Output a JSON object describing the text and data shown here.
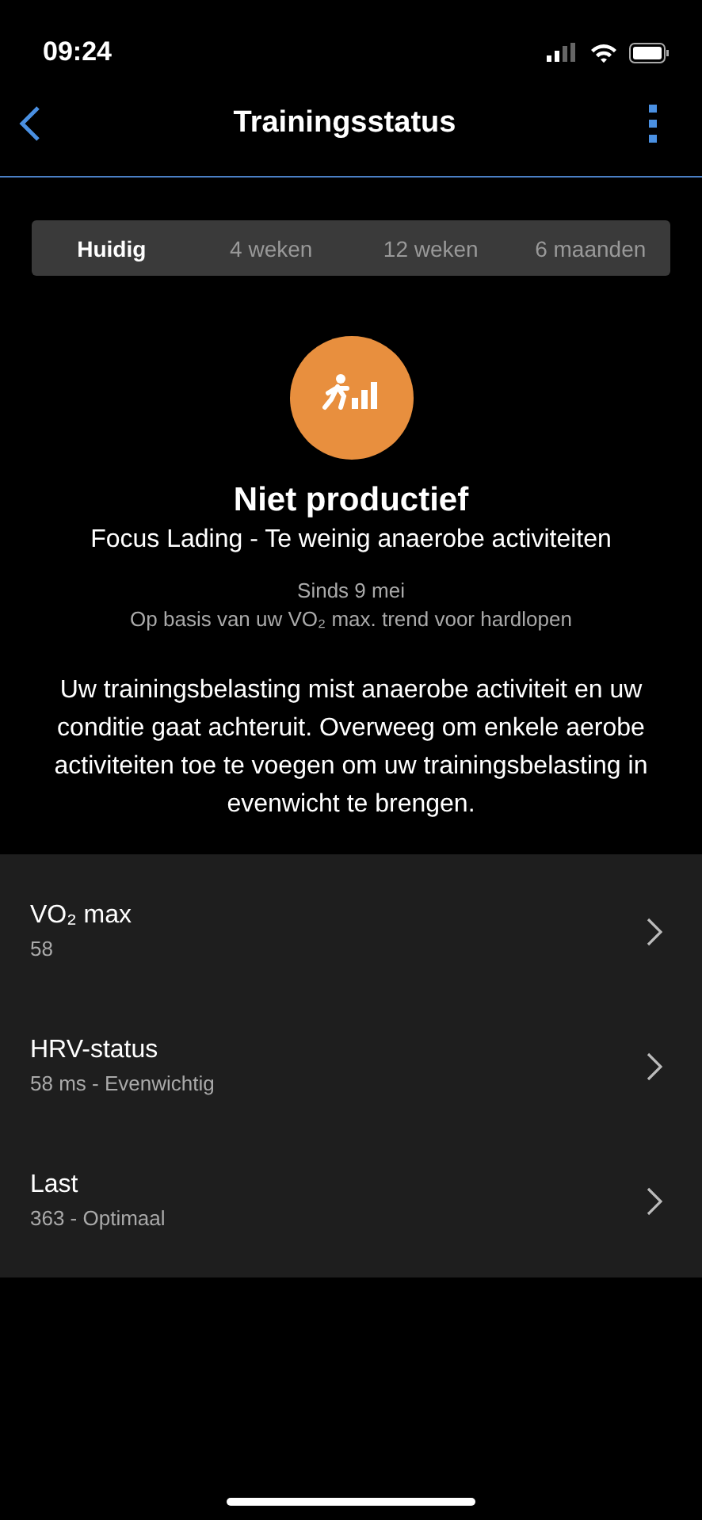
{
  "status_bar": {
    "time": "09:24"
  },
  "nav": {
    "title": "Trainingsstatus"
  },
  "tabs": [
    {
      "label": "Huidig",
      "selected": true
    },
    {
      "label": "4 weken",
      "selected": false
    },
    {
      "label": "12 weken",
      "selected": false
    },
    {
      "label": "6 maanden",
      "selected": false
    }
  ],
  "status": {
    "title": "Niet productief",
    "subtitle": "Focus Lading - Te weinig anaerobe activiteiten",
    "since": "Sinds 9 mei",
    "basis": "Op basis van uw VO₂ max. trend voor hardlopen",
    "description": "Uw trainingsbelasting mist anaerobe activiteit en uw conditie gaat achteruit. Overweeg om enkele aerobe activiteiten toe te voegen om uw trainingsbelasting in evenwicht te brengen."
  },
  "metrics": [
    {
      "label": "VO₂ max",
      "value": "58"
    },
    {
      "label": "HRV-status",
      "value": "58 ms - Evenwichtig"
    },
    {
      "label": "Last",
      "value": "363 - Optimaal"
    }
  ]
}
